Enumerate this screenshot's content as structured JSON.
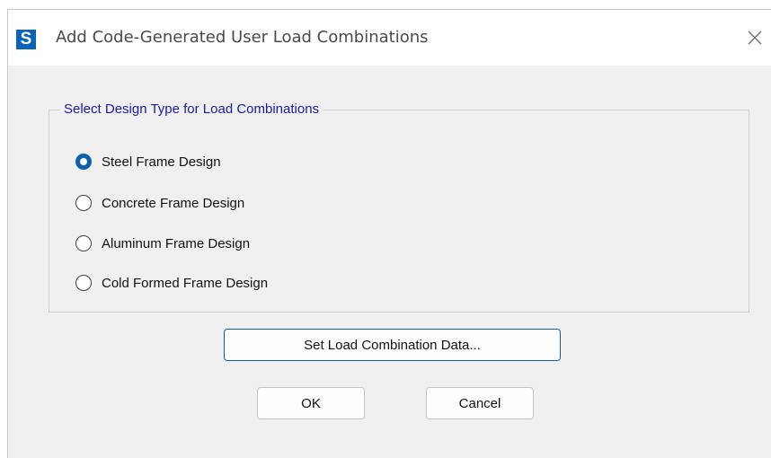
{
  "window": {
    "title": "Add Code-Generated User Load Combinations",
    "app_icon_letter": "S",
    "close_glyph": "close-icon"
  },
  "group": {
    "legend": "Select Design Type for Load Combinations",
    "options": [
      {
        "label": "Steel Frame Design",
        "checked": true
      },
      {
        "label": "Concrete Frame Design",
        "checked": false
      },
      {
        "label": "Aluminum Frame Design",
        "checked": false
      },
      {
        "label": "Cold Formed Frame Design",
        "checked": false
      }
    ]
  },
  "buttons": {
    "set_data": "Set Load Combination Data...",
    "ok": "OK",
    "cancel": "Cancel"
  },
  "colors": {
    "accent": "#0f5fb0",
    "legend_text": "#1a1aa8",
    "app_icon_bg": "#0b63b8"
  }
}
